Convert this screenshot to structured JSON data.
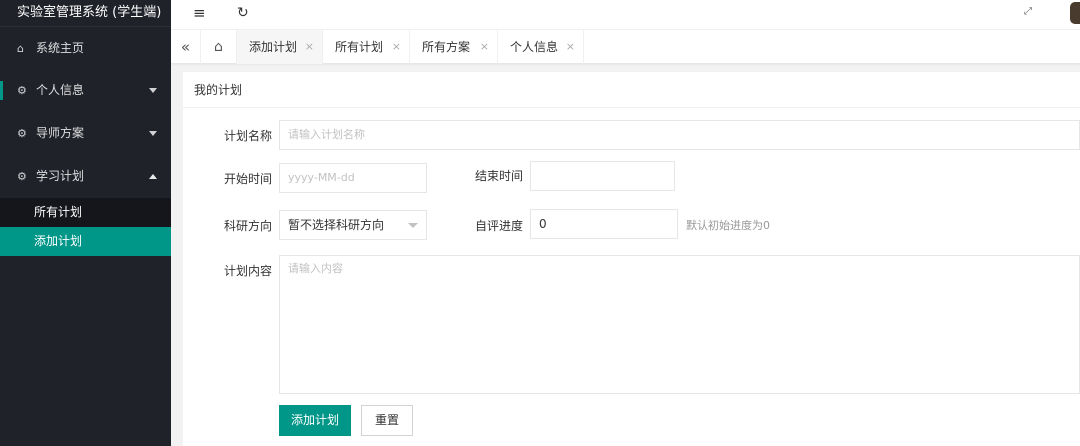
{
  "app": {
    "title": "实验室管理系统 (学生端)"
  },
  "sidebar": {
    "items": [
      {
        "label": "系统主页",
        "icon": "home-icon"
      },
      {
        "label": "个人信息",
        "icon": "gear-icon"
      },
      {
        "label": "导师方案",
        "icon": "gear-icon"
      },
      {
        "label": "学习计划",
        "icon": "gear-icon"
      }
    ],
    "sub_items": [
      {
        "label": "所有计划"
      },
      {
        "label": "添加计划"
      }
    ]
  },
  "tabs": [
    {
      "label": "添加计划"
    },
    {
      "label": "所有计划"
    },
    {
      "label": "所有方案"
    },
    {
      "label": "个人信息"
    }
  ],
  "card": {
    "title": "我的计划"
  },
  "form": {
    "name_label": "计划名称",
    "name_placeholder": "请输入计划名称",
    "start_label": "开始时间",
    "start_placeholder": "yyyy-MM-dd",
    "end_label": "结束时间",
    "direction_label": "科研方向",
    "direction_value": "暂不选择科研方向",
    "progress_label": "自评进度",
    "progress_value": "0",
    "progress_hint": "默认初始进度为0",
    "content_label": "计划内容",
    "content_placeholder": "请输入内容",
    "submit_label": "添加计划",
    "reset_label": "重置"
  },
  "colors": {
    "accent": "#009688",
    "sidebar_bg": "#20222a",
    "subnav_bg": "#15161b"
  }
}
